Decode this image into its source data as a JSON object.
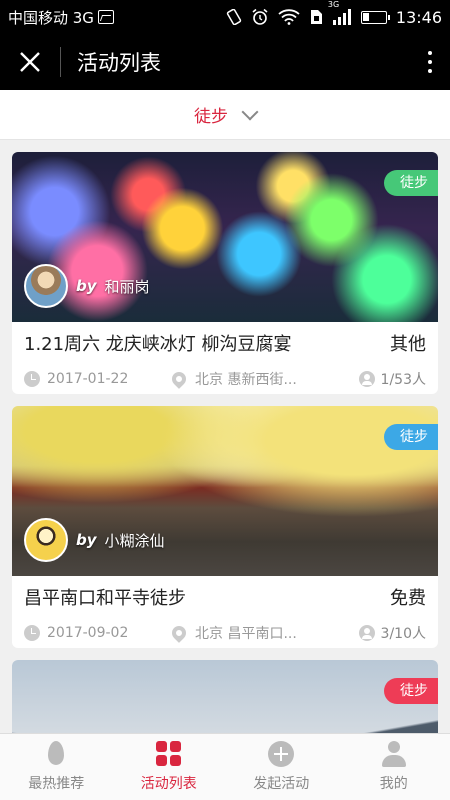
{
  "status_bar": {
    "carrier": "中国移动 3G",
    "network_badge": "3G",
    "time": "13:46",
    "icons": [
      "image-icon",
      "vibrate-icon",
      "alarm-icon",
      "wifi-icon",
      "sim-icon",
      "signal-icon",
      "battery-icon"
    ]
  },
  "header": {
    "title": "活动列表",
    "close_icon": "close-icon",
    "more_icon": "more-vertical-icon"
  },
  "filter": {
    "selected": "徒步",
    "icon": "chevron-down-icon"
  },
  "activities": [
    {
      "tag": "徒步",
      "tag_color": "#46c878",
      "by": "by",
      "author": "和丽岗",
      "title": "1.21周六 龙庆峡冰灯 柳沟豆腐宴",
      "price": "其他",
      "date": "2017-01-22",
      "location": "北京 惠新西街...",
      "participants": "1/53人"
    },
    {
      "tag": "徒步",
      "tag_color": "#3ca8e6",
      "by": "by",
      "author": "小糊涂仙",
      "title": "昌平南口和平寺徒步",
      "price": "免费",
      "date": "2017-09-02",
      "location": "北京 昌平南口...",
      "participants": "3/10人"
    },
    {
      "tag": "徒步",
      "tag_color": "#ee3c56"
    }
  ],
  "bottom_nav": {
    "items": [
      {
        "label": "最热推荐",
        "icon": "flame-icon"
      },
      {
        "label": "活动列表",
        "icon": "grid-icon",
        "active": true
      },
      {
        "label": "发起活动",
        "icon": "plus-circle-icon"
      },
      {
        "label": "我的",
        "icon": "user-icon"
      }
    ],
    "active_color": "#d9263f"
  }
}
